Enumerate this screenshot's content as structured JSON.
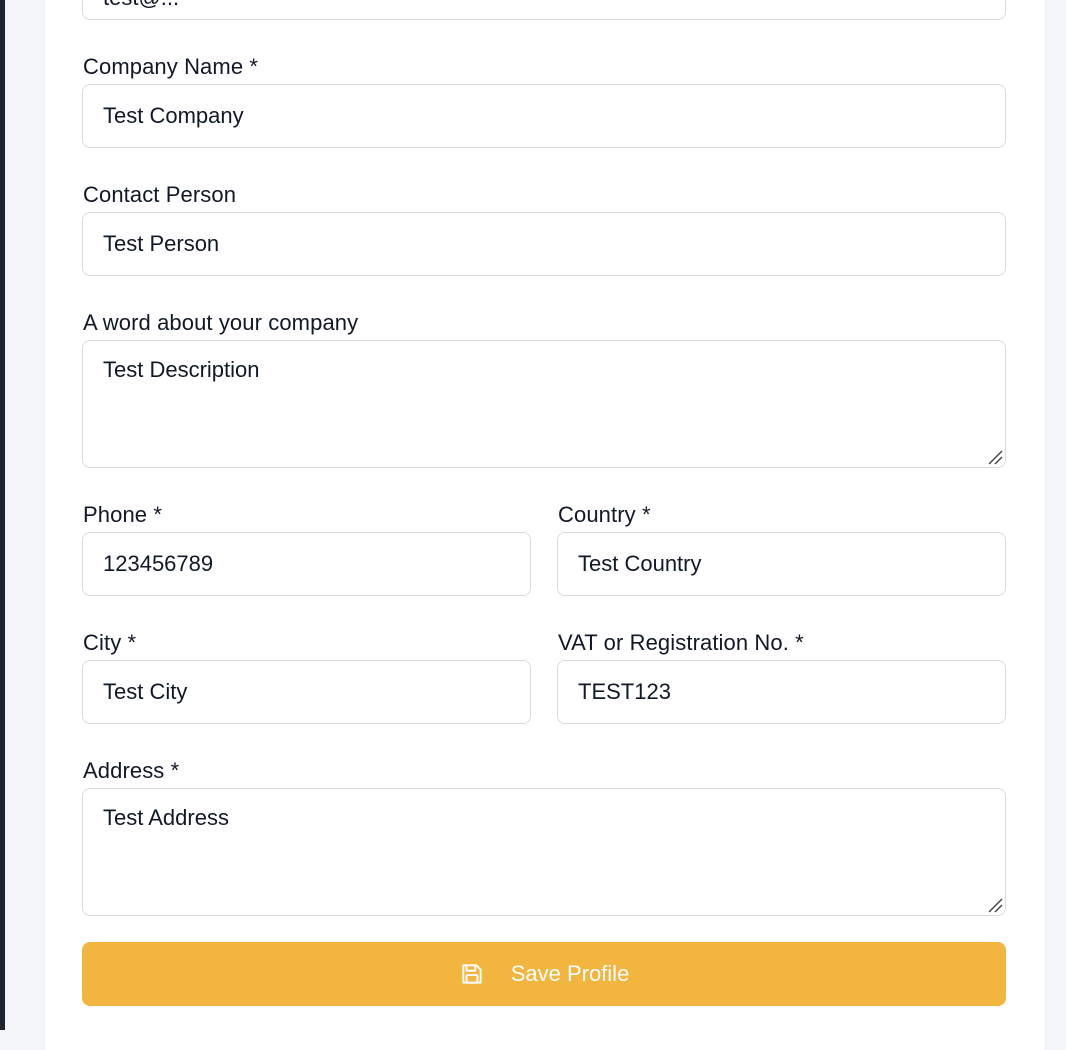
{
  "form": {
    "top_field_partial_value": "test@...",
    "company_name": {
      "label": "Company Name *",
      "value": "Test Company"
    },
    "contact_person": {
      "label": "Contact Person",
      "value": "Test Person"
    },
    "about": {
      "label": "A word about your company",
      "value": "Test Description"
    },
    "phone": {
      "label": "Phone *",
      "value": "123456789"
    },
    "country": {
      "label": "Country *",
      "value": "Test Country"
    },
    "city": {
      "label": "City *",
      "value": "Test City"
    },
    "vat": {
      "label": "VAT or Registration No. *",
      "value": "TEST123"
    },
    "address": {
      "label": "Address *",
      "value": "Test Address"
    },
    "save_button": {
      "label": "Save Profile",
      "icon": "save-icon"
    }
  },
  "colors": {
    "accent": "#f2b53f",
    "border": "#d7dbe0",
    "sidebar_edge": "#1f2430"
  }
}
